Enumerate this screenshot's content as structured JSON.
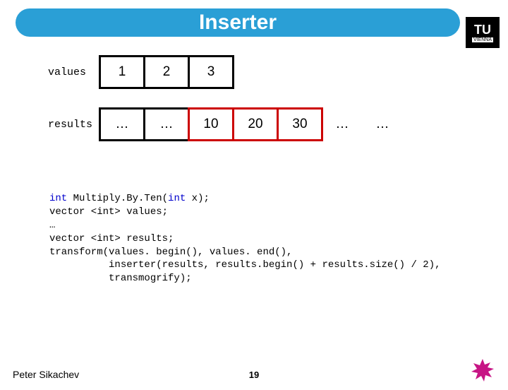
{
  "header": {
    "title": "Inserter"
  },
  "logo": {
    "top": "TU",
    "bottom": "VIENNA"
  },
  "diagram": {
    "values_label": "values",
    "values_cells": [
      "1",
      "2",
      "3"
    ],
    "results_label": "results",
    "results_black_left": [
      "…",
      "…"
    ],
    "results_red": [
      "10",
      "20",
      "30"
    ],
    "results_trail": [
      "…",
      "…"
    ]
  },
  "code": {
    "l1a": "int",
    "l1b": " Multiply.By.Ten(",
    "l1c": "int",
    "l1d": " x);",
    "l2": "",
    "l3a": "vector <int> values;",
    "l4": "…",
    "l5a": "vector <int> results;",
    "l6": "transform(values. begin(), values. end(),",
    "l7": "          inserter(results, results.begin() + results.size() / 2),",
    "l8": "          transmogrify);"
  },
  "footer": {
    "author": "Peter Sikachev",
    "page": "19"
  }
}
